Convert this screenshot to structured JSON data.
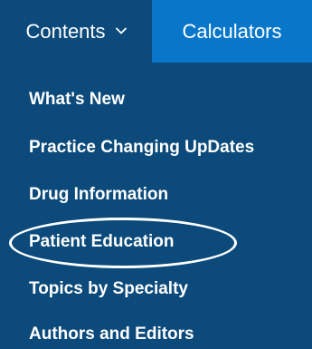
{
  "nav": {
    "contents_label": "Contents",
    "calculators_label": "Calculators"
  },
  "menu": {
    "items": [
      {
        "label": "What's New"
      },
      {
        "label": "Practice Changing UpDates"
      },
      {
        "label": "Drug Information"
      },
      {
        "label": "Patient Education"
      },
      {
        "label": "Topics by Specialty"
      },
      {
        "label": "Authors and Editors"
      }
    ]
  },
  "colors": {
    "panel_bg": "#0b4a7a",
    "calculators_bg": "#0877c9",
    "text": "#ffffff",
    "decorative_shape": "#c9bde3"
  },
  "icons": {
    "contents_dropdown": "chevron-down-icon"
  },
  "annotation": {
    "highlighted_item": "Patient Education"
  }
}
